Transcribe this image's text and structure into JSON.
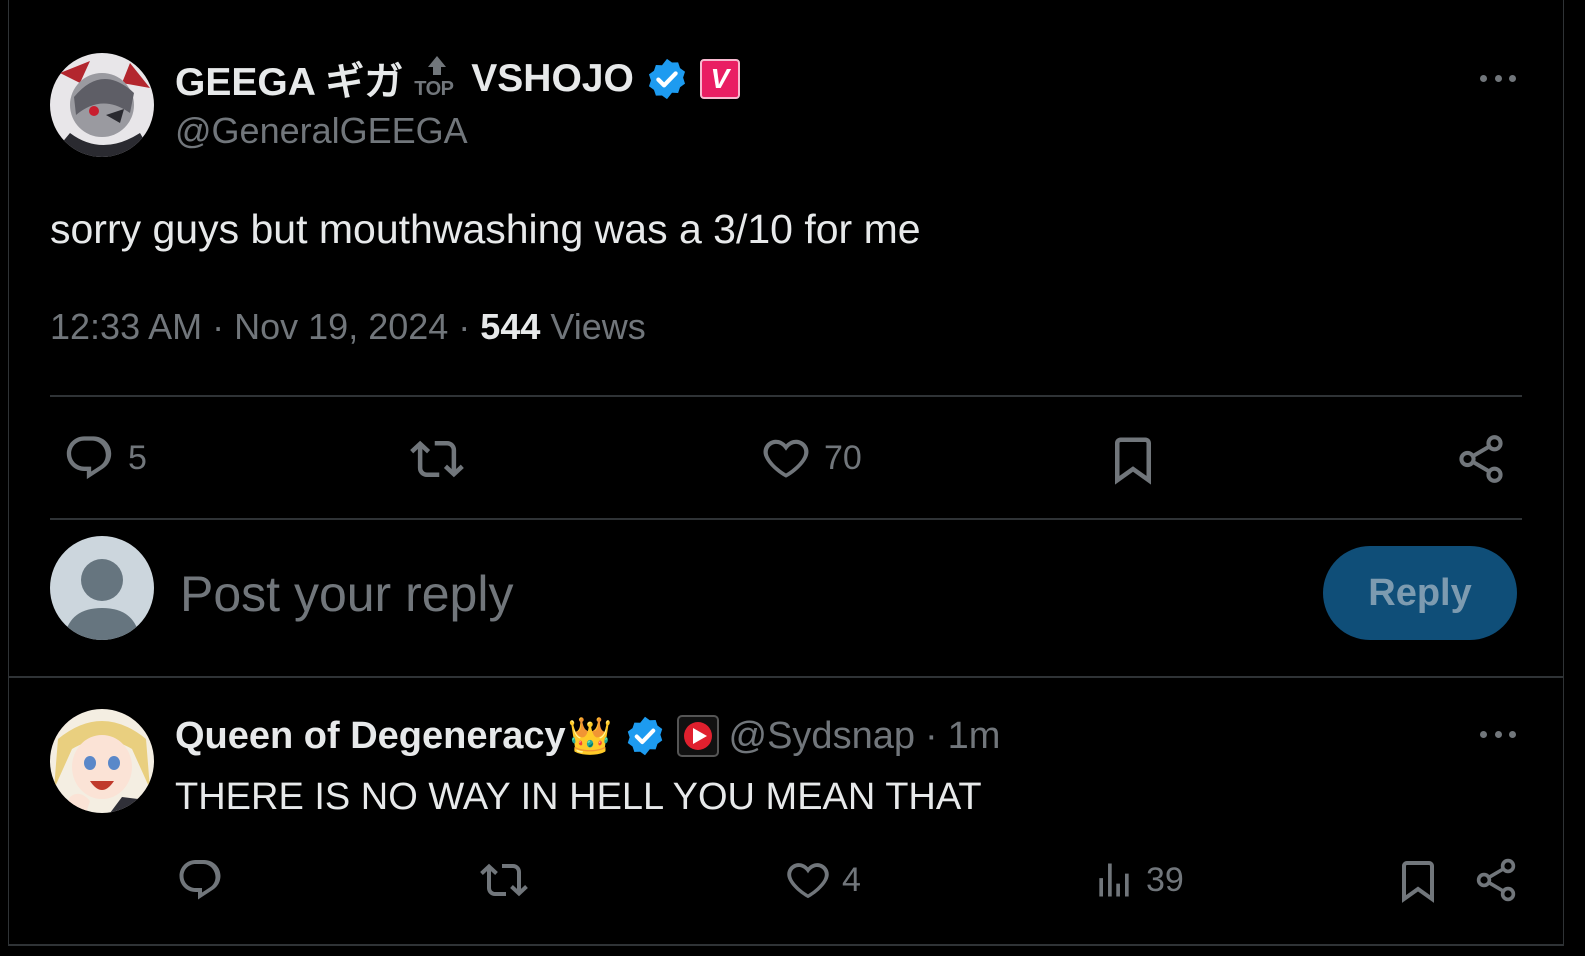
{
  "tweet": {
    "display_name": "GEEGA ギガ",
    "top_badge_label": "TOP",
    "org_name": "VSHOJO",
    "affiliate_badge_letter": "V",
    "handle": "@GeneralGEEGA",
    "text": "sorry guys but mouthwashing was a 3/10 for me",
    "time": "12:33 AM",
    "date": "Nov 19, 2024",
    "views_count": "544",
    "views_label": "Views",
    "actions": {
      "replies": "5",
      "likes": "70"
    }
  },
  "composer": {
    "placeholder": "Post your reply",
    "reply_button": "Reply"
  },
  "reply": {
    "display_name": "Queen of Degeneracy",
    "crown_emoji": "👑",
    "handle": "@Sydsnap",
    "age": "1m",
    "text": "THERE IS NO WAY IN HELL YOU MEAN THAT",
    "actions": {
      "likes": "4",
      "views": "39"
    }
  },
  "colors": {
    "background": "#000000",
    "text": "#e7e9ea",
    "muted": "#71767b",
    "verified_blue": "#1d9bf0",
    "vshojo_pink": "#e91e63",
    "reply_button": "#0f4e78",
    "divider": "#2f3336"
  },
  "icons": [
    "avatar-illustration",
    "verified-badge-icon",
    "vshojo-badge-icon",
    "top-arrow-icon",
    "more-icon",
    "reply-icon",
    "repost-icon",
    "like-icon",
    "bookmark-icon",
    "share-icon",
    "views-icon",
    "default-avatar-icon",
    "affiliate-play-icon"
  ]
}
